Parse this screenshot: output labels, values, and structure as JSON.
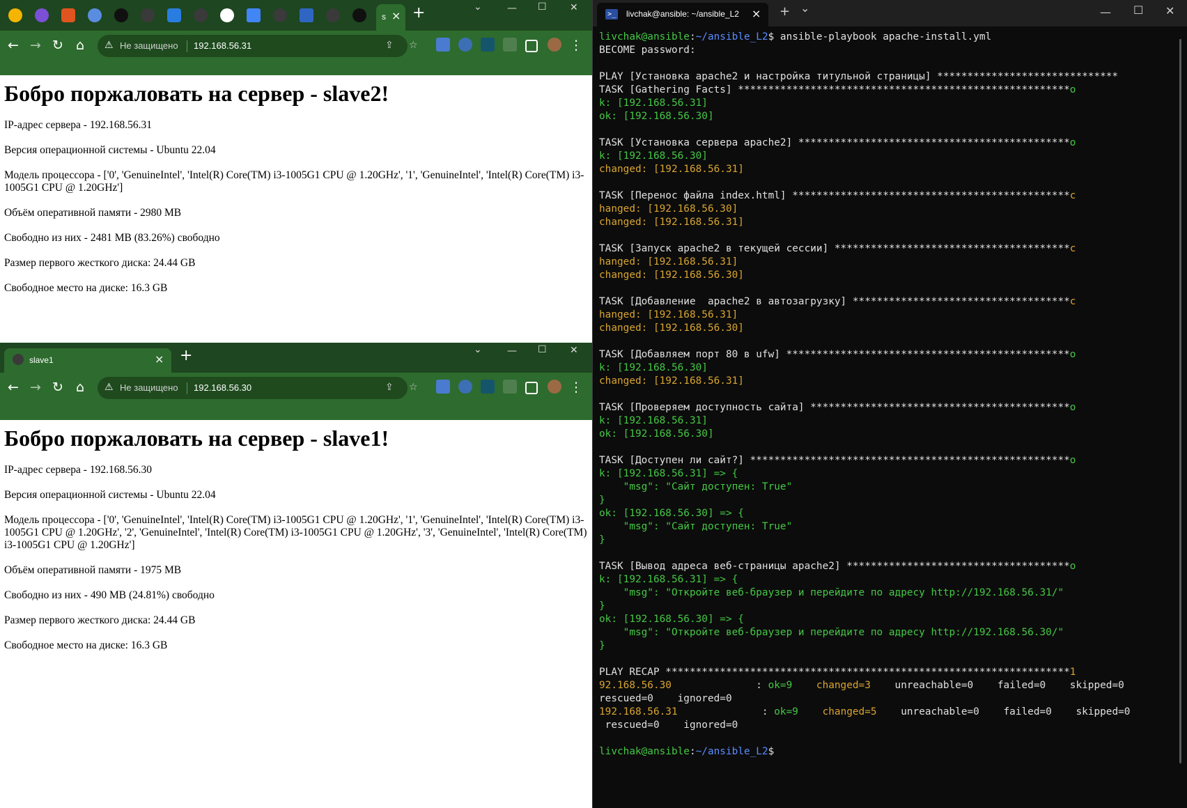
{
  "browser_top": {
    "tab_active_label": "s",
    "url_insecure": "Не защищено",
    "url": "192.168.56.31",
    "page": {
      "heading": "Бобро поржаловать на сервер - slave2!",
      "lines": [
        "IP-адрес сервера - 192.168.56.31",
        "Версия операционной системы - Ubuntu 22.04",
        "Модель процессора - ['0', 'GenuineIntel', 'Intel(R) Core(TM) i3-1005G1 CPU @ 1.20GHz', '1', 'GenuineIntel', 'Intel(R) Core(TM) i3-1005G1 CPU @ 1.20GHz']",
        "Объём оперативной памяти - 2980 MB",
        "Свободно из них - 2481 MB (83.26%) свободно",
        "Размер первого жесткого диска: 24.44 GB",
        "Свободное место на диске: 16.3 GB"
      ]
    }
  },
  "browser_bottom": {
    "tab_title": "slave1",
    "url_insecure": "Не защищено",
    "url": "192.168.56.30",
    "page": {
      "heading": "Бобро поржаловать на сервер - slave1!",
      "lines": [
        "IP-адрес сервера - 192.168.56.30",
        "Версия операционной системы - Ubuntu 22.04",
        "Модель процессора - ['0', 'GenuineIntel', 'Intel(R) Core(TM) i3-1005G1 CPU @ 1.20GHz', '1', 'GenuineIntel', 'Intel(R) Core(TM) i3-1005G1 CPU @ 1.20GHz', '2', 'GenuineIntel', 'Intel(R) Core(TM) i3-1005G1 CPU @ 1.20GHz', '3', 'GenuineIntel', 'Intel(R) Core(TM) i3-1005G1 CPU @ 1.20GHz']",
        "Объём оперативной памяти - 1975 MB",
        "Свободно из них - 490 MB (24.81%) свободно",
        "Размер первого жесткого диска: 24.44 GB",
        "Свободное место на диске: 16.3 GB"
      ]
    }
  },
  "terminal": {
    "tab_title": "livchak@ansible: ~/ansible_L2",
    "lines": [
      [
        [
          "g",
          "livchak@ansible"
        ],
        [
          "w",
          ":"
        ],
        [
          "b",
          "~/ansible_L2"
        ],
        [
          "w",
          "$ ansible-playbook apache-install.yml"
        ]
      ],
      [
        [
          "w",
          "BECOME password:"
        ]
      ],
      [],
      [
        [
          "w",
          "PLAY [Установка apache2 и настройка титульной страницы] ******************************"
        ]
      ],
      [
        [
          "w",
          "TASK [Gathering Facts] *******************************************************"
        ],
        [
          "g",
          "o"
        ]
      ],
      [
        [
          "g",
          "k: [192.168.56.31]"
        ]
      ],
      [
        [
          "g",
          "ok: [192.168.56.30]"
        ]
      ],
      [],
      [
        [
          "w",
          "TASK [Установка сервера apache2] *********************************************"
        ],
        [
          "g",
          "o"
        ]
      ],
      [
        [
          "g",
          "k: [192.168.56.30]"
        ]
      ],
      [
        [
          "y",
          "changed: [192.168.56.31]"
        ]
      ],
      [],
      [
        [
          "w",
          "TASK [Перенос файла index.html] **********************************************"
        ],
        [
          "y",
          "c"
        ]
      ],
      [
        [
          "y",
          "hanged: [192.168.56.30]"
        ]
      ],
      [
        [
          "y",
          "changed: [192.168.56.31]"
        ]
      ],
      [],
      [
        [
          "w",
          "TASK [Запуск apache2 в текущей сессии] ***************************************"
        ],
        [
          "y",
          "c"
        ]
      ],
      [
        [
          "y",
          "hanged: [192.168.56.31]"
        ]
      ],
      [
        [
          "y",
          "changed: [192.168.56.30]"
        ]
      ],
      [],
      [
        [
          "w",
          "TASK [Добавление  apache2 в автозагрузку] ************************************"
        ],
        [
          "y",
          "c"
        ]
      ],
      [
        [
          "y",
          "hanged: [192.168.56.31]"
        ]
      ],
      [
        [
          "y",
          "changed: [192.168.56.30]"
        ]
      ],
      [],
      [
        [
          "w",
          "TASK [Добавляем порт 80 в ufw] ***********************************************"
        ],
        [
          "g",
          "o"
        ]
      ],
      [
        [
          "g",
          "k: [192.168.56.30]"
        ]
      ],
      [
        [
          "y",
          "changed: [192.168.56.31]"
        ]
      ],
      [],
      [
        [
          "w",
          "TASK [Проверяем доступность сайта] *******************************************"
        ],
        [
          "g",
          "o"
        ]
      ],
      [
        [
          "g",
          "k: [192.168.56.31]"
        ]
      ],
      [
        [
          "g",
          "ok: [192.168.56.30]"
        ]
      ],
      [],
      [
        [
          "w",
          "TASK [Доступен ли сайт?] *****************************************************"
        ],
        [
          "g",
          "o"
        ]
      ],
      [
        [
          "g",
          "k: [192.168.56.31] => {"
        ]
      ],
      [
        [
          "g",
          "    \"msg\": \"Сайт доступен: True\""
        ]
      ],
      [
        [
          "g",
          "}"
        ]
      ],
      [
        [
          "g",
          "ok: [192.168.56.30] => {"
        ]
      ],
      [
        [
          "g",
          "    \"msg\": \"Сайт доступен: True\""
        ]
      ],
      [
        [
          "g",
          "}"
        ]
      ],
      [],
      [
        [
          "w",
          "TASK [Вывод адреса веб-страницы apache2] *************************************"
        ],
        [
          "g",
          "o"
        ]
      ],
      [
        [
          "g",
          "k: [192.168.56.31] => {"
        ]
      ],
      [
        [
          "g",
          "    \"msg\": \"Откройте веб-браузер и перейдите по адресу http://192.168.56.31/\""
        ]
      ],
      [
        [
          "g",
          "}"
        ]
      ],
      [
        [
          "g",
          "ok: [192.168.56.30] => {"
        ]
      ],
      [
        [
          "g",
          "    \"msg\": \"Откройте веб-браузер и перейдите по адресу http://192.168.56.30/\""
        ]
      ],
      [
        [
          "g",
          "}"
        ]
      ],
      [],
      [
        [
          "w",
          "PLAY RECAP *******************************************************************"
        ],
        [
          "y",
          "1"
        ]
      ],
      [
        [
          "y",
          "92.168.56.30"
        ],
        [
          "w",
          "              : "
        ],
        [
          "g",
          "ok=9"
        ],
        [
          "w",
          "    "
        ],
        [
          "y",
          "changed=3"
        ],
        [
          "w",
          "    unreachable=0    failed=0    skipped=0"
        ]
      ],
      [
        [
          "w",
          "rescued=0    ignored=0"
        ]
      ],
      [
        [
          "y",
          "192.168.56.31"
        ],
        [
          "w",
          "              : "
        ],
        [
          "g",
          "ok=9"
        ],
        [
          "w",
          "    "
        ],
        [
          "y",
          "changed=5"
        ],
        [
          "w",
          "    unreachable=0    failed=0    skipped=0"
        ]
      ],
      [
        [
          "w",
          " rescued=0    ignored=0"
        ]
      ],
      [],
      [
        [
          "g",
          "livchak@ansible"
        ],
        [
          "w",
          ":"
        ],
        [
          "b",
          "~/ansible_L2"
        ],
        [
          "w",
          "$"
        ]
      ]
    ]
  },
  "colors": {
    "browser_tabstrip": "#1e4620",
    "browser_toolbar": "#2e6b2e",
    "terminal_bg": "#0c0c0c",
    "term_green": "#45c845",
    "term_yellow": "#d9a530",
    "term_blue": "#5b8dff"
  },
  "icons": {
    "new_tab": "+",
    "tab_close": "×",
    "minimize": "—",
    "maximize": "☐",
    "window_close": "✕",
    "back": "←",
    "forward": "→",
    "reload": "↻",
    "home": "⌂",
    "warning": "⚠",
    "share": "⇪",
    "star": "☆",
    "menu": "⋮",
    "dropdown": "⌄"
  }
}
